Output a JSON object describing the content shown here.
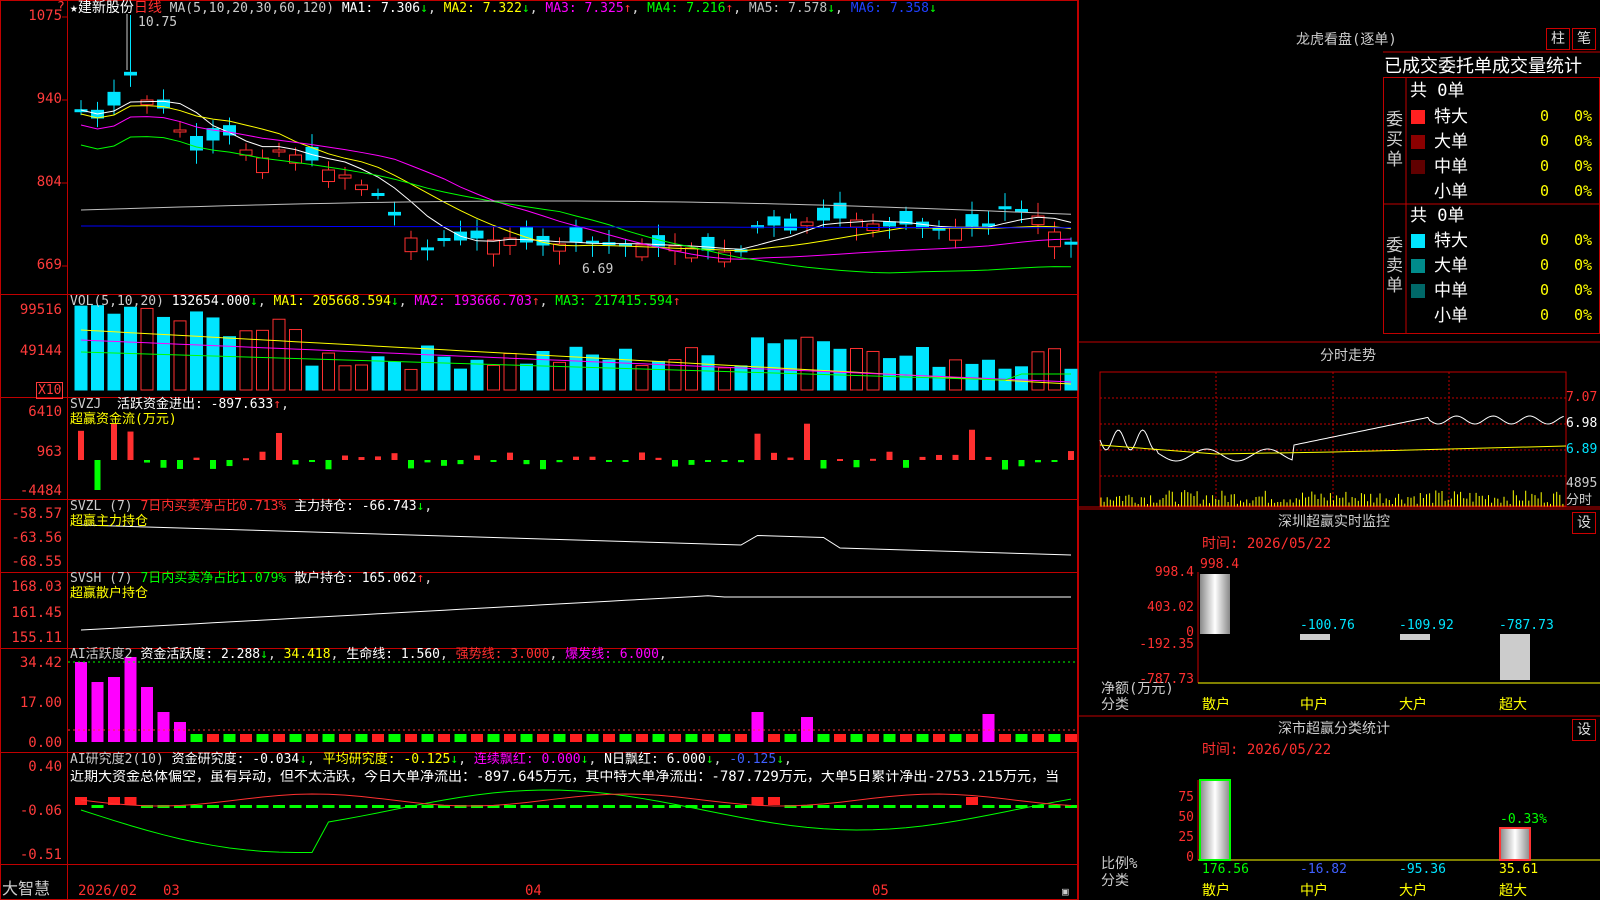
{
  "colors": {
    "up": "#ff3030",
    "down": "#00e5ff",
    "grid": "#c00000",
    "ma1": "#ffffff",
    "ma2": "#ffff00",
    "ma3": "#ff00ff",
    "ma4": "#00ff00",
    "ma5": "#c0c0c0",
    "ma6": "#0000ff"
  },
  "price": {
    "corner_mark": "?",
    "y_labels": [
      "1075",
      "940",
      "804",
      "669"
    ],
    "title_star": "★",
    "stock": "建新股份",
    "period": "日线",
    "ma_def": "MA(5,10,20,30,60,120)",
    "ma": [
      {
        "label": "MA1: 7.306",
        "arrow": "↓"
      },
      {
        "label": "MA2: 7.322",
        "arrow": "↓"
      },
      {
        "label": "MA3: 7.325",
        "arrow": "↑"
      },
      {
        "label": "MA4: 7.216",
        "arrow": "↑"
      },
      {
        "label": "MA5: 7.578",
        "arrow": "↓"
      },
      {
        "label": "MA6: 7.358",
        "arrow": "↓"
      }
    ],
    "high_label": "10.75",
    "low_label": "6.69"
  },
  "vol": {
    "y_labels": [
      "99516",
      "49144"
    ],
    "unit": "X10",
    "title": "VOL(5,10,20)",
    "value": "132654.000",
    "arrow": "↓",
    "ma1": "MA1: 205668.594",
    "ma1_arrow": "↓",
    "ma2": "MA2: 193666.703",
    "ma2_arrow": "↑",
    "ma3": "MA3: 217415.594",
    "ma3_arrow": "↑"
  },
  "svzj": {
    "y_labels": [
      "6410",
      "963",
      "-4484"
    ],
    "title": "SVZJ",
    "desc": "活跃资金进出: -897.633",
    "arrow": "↑",
    "sub": "超赢资金流(万元)"
  },
  "svzl": {
    "y_labels": [
      "-58.57",
      "-63.56",
      "-68.55"
    ],
    "title": "SVZL (7)",
    "pct": "7日内买卖净占比0.713%",
    "hold": "主力持仓: -66.743",
    "arrow": "↓",
    "sub": "超赢主力持仓"
  },
  "svsh": {
    "y_labels": [
      "168.03",
      "161.45",
      "155.11"
    ],
    "title": "SVSH (7)",
    "pct": "7日内买卖净占比1.079%",
    "hold": "散户持仓: 165.062",
    "arrow": "↑",
    "sub": "超赢散户持仓"
  },
  "ai1": {
    "y_labels": [
      "34.42",
      "17.00",
      "0.00"
    ],
    "title": "AI活跃度2",
    "a": "资金活跃度: 2.288",
    "a_arrow": "↓",
    "b": "34.418",
    "c": "生命线: 1.560",
    "d": "强势线: 3.000",
    "e": "爆发线: 6.000"
  },
  "ai2": {
    "y_labels": [
      "0.40",
      "-0.06",
      "-0.51"
    ],
    "title": "AI研究度2(10)",
    "a": "资金研究度: -0.034",
    "a_arrow": "↓",
    "b": "平均研究度: -0.125",
    "b_arrow": "↓",
    "c": "连续飘红: 0.000",
    "c_arrow": "↓",
    "d": "N日飘红: 6.000",
    "d_arrow": "↓",
    "e": "-0.125",
    "e_arrow": "↓",
    "text": "近期大资金总体偏空，虽有异动，但不太活跃，今日大单净流出：-897.645万元，其中特大单净流出：-787.729万元，大单5日累计净出-2753.215万元，当"
  },
  "bottom": {
    "brand": "大智慧",
    "dates": [
      "2026/02",
      "03",
      "04",
      "05"
    ]
  },
  "lhb": {
    "title": "龙虎看盘(逐单)",
    "btn1": "柱",
    "btn2": "笔",
    "header": "已成交委托单成交量统计",
    "buy_label": "委买单",
    "sell_label": "委卖单",
    "buy_total": "共 0单",
    "sell_total": "共 0单",
    "rows": [
      {
        "name": "特大",
        "n": "0",
        "p": "0%"
      },
      {
        "name": "大单",
        "n": "0",
        "p": "0%"
      },
      {
        "name": "中单",
        "n": "0",
        "p": "0%"
      },
      {
        "name": "小单",
        "n": "0",
        "p": "0%"
      }
    ]
  },
  "fenshi": {
    "title": "分时走势",
    "y_labels": [
      "7.07",
      "6.98",
      "6.89"
    ],
    "vol_label": "4895",
    "time_label": "分时"
  },
  "sz1": {
    "title": "深圳超赢实时监控",
    "btn": "设",
    "time": "时间: 2026/05/22",
    "y_labels": [
      "998.4",
      "403.02",
      "0",
      "-192.35",
      "-787.73"
    ],
    "ylabel": "净额(万元)",
    "xlabel": "分类",
    "cats": [
      "散户",
      "中户",
      "大户",
      "超大"
    ],
    "vals": [
      "998.4",
      "-100.76",
      "-109.92",
      "-787.73"
    ]
  },
  "sz2": {
    "title": "深市超赢分类统计",
    "btn": "设",
    "time": "时间: 2026/05/22",
    "y_labels": [
      "75",
      "50",
      "25",
      "0"
    ],
    "ylabel": "比例%",
    "xlabel": "分类",
    "cats": [
      "散户",
      "中户",
      "大户",
      "超大"
    ],
    "vals": [
      "176.56",
      "-16.82",
      "-95.36",
      "35.61"
    ],
    "pct_label": "-0.33%"
  }
}
